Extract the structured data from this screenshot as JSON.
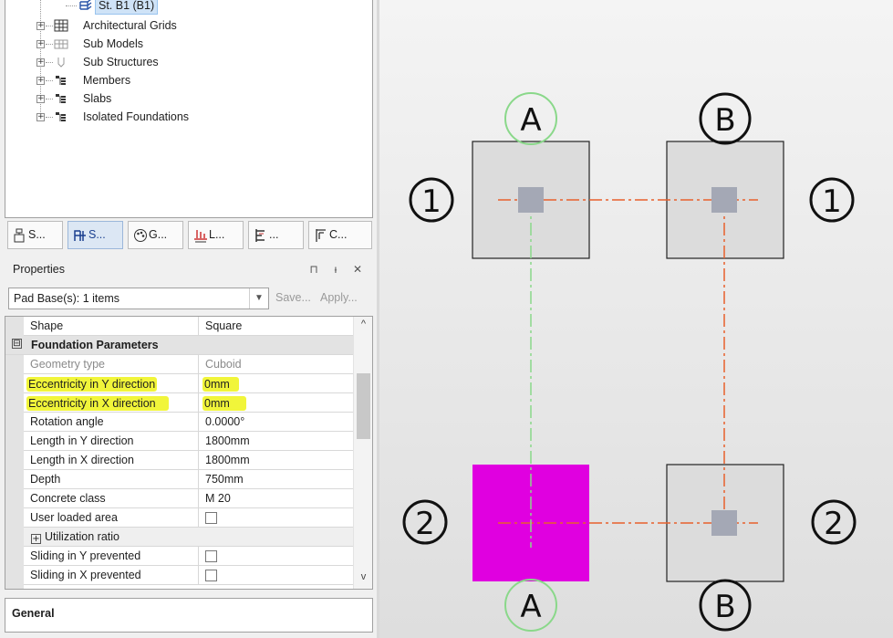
{
  "tree": {
    "items": [
      {
        "label": "St. B1 (B1)",
        "selected": true
      },
      {
        "label": "Architectural Grids"
      },
      {
        "label": "Sub Models"
      },
      {
        "label": "Sub Structures"
      },
      {
        "label": "Members"
      },
      {
        "label": "Slabs"
      },
      {
        "label": "Isolated Foundations"
      }
    ],
    "expander_glyph": "+"
  },
  "tabs": [
    {
      "label": "S..."
    },
    {
      "label": "S...",
      "active": true
    },
    {
      "label": "G..."
    },
    {
      "label": "L..."
    },
    {
      "label": "..."
    },
    {
      "label": "C..."
    }
  ],
  "properties": {
    "title": "Properties",
    "pin_glyph": "⊓",
    "autohide_glyph": "ᵻ",
    "close_glyph": "✕",
    "selector_value": "Pad Base(s): 1 items",
    "save_label": "Save...",
    "apply_label": "Apply...",
    "rows": [
      {
        "name": "Shape",
        "value": "Square"
      },
      {
        "name": "Foundation Parameters",
        "group_glyph": "⊟"
      },
      {
        "name": "Geometry type",
        "value": "Cuboid"
      },
      {
        "name": "Eccentricity in Y direction",
        "value": "0mm"
      },
      {
        "name": "Eccentricity in X direction",
        "value": "0mm"
      },
      {
        "name": "Rotation angle",
        "value": "0.0000°"
      },
      {
        "name": "Length in Y direction",
        "value": "1800mm"
      },
      {
        "name": "Length in X direction",
        "value": "1800mm"
      },
      {
        "name": "Depth",
        "value": "750mm"
      },
      {
        "name": "Concrete class",
        "value": "M 20"
      },
      {
        "name": "User loaded area",
        "checked": false
      },
      {
        "name": "Utilization ratio",
        "sub_glyph": "+"
      },
      {
        "name": "Sliding in Y prevented",
        "checked": false
      },
      {
        "name": "Sliding in X prevented",
        "checked": false
      }
    ],
    "scroll_up": "^",
    "scroll_down": "v",
    "category_label": "General"
  },
  "viewport": {
    "grid_labels": {
      "col_a": "A",
      "col_b": "B",
      "row_1": "1",
      "row_2": "2"
    },
    "colors": {
      "footing_fill": "#dcdcdc",
      "footing_selected": "#e000e0",
      "column_fill": "#a4a8b5",
      "grid_line": "#e8602c",
      "selected_grid_line": "#8ad88a"
    }
  }
}
